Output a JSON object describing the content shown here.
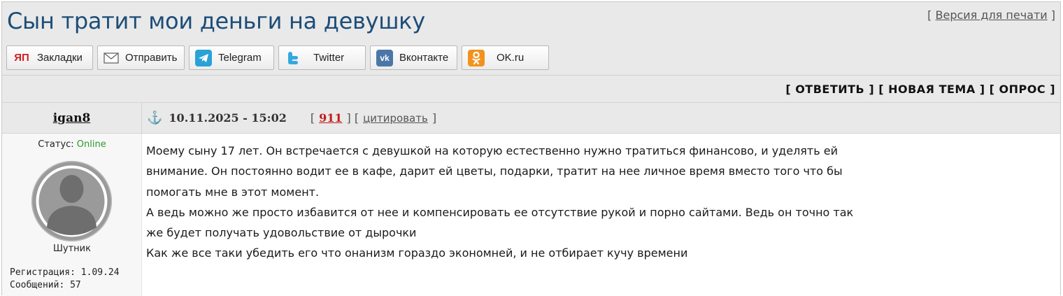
{
  "topic": {
    "title": "Сын тратит мои деньги на девушку",
    "print_prefix": "[ ",
    "print_label": "Версия для печати",
    "print_suffix": " ]"
  },
  "share_buttons": [
    {
      "label": "Закладки",
      "icon": "yandex-bookmarks-icon",
      "icon_text": "ЯП"
    },
    {
      "label": "Отправить",
      "icon": "envelope-icon"
    },
    {
      "label": "Telegram",
      "icon": "telegram-icon"
    },
    {
      "label": "Twitter",
      "icon": "twitter-icon"
    },
    {
      "label": "Вконтакте",
      "icon": "vk-icon",
      "icon_text": "vk"
    },
    {
      "label": "OK.ru",
      "icon": "odnoklassniki-icon"
    }
  ],
  "actions": {
    "reply": "[ ОТВЕТИТЬ ]",
    "new_topic": "[ НОВАЯ ТЕМА ]",
    "poll": "[ ОПРОС ]"
  },
  "post": {
    "author": "igan8",
    "date": "10.11.2025 - 15:02",
    "number": "911",
    "quote_label": "цитировать",
    "status_label": "Статус: ",
    "status_value": "Online",
    "rank": "Шутник",
    "registration": "Регистрация: 1.09.24",
    "messages": "Сообщений: 57",
    "lines": [
      "Моему сыну 17 лет. Он встречается с девушкой на которую естественно нужно тратиться финансово, и уделять ей",
      "внимание. Он постоянно водит ее в кафе, дарит ей цветы, подарки, тратит на нее личное время вместо того что бы",
      "помогать мне в этот момент.",
      "А ведь можно же просто избавится от нее и компенсировать ее отсутствие рукой и порно сайтами. Ведь он точно так",
      "же будет получать удовольствие от дырочки",
      "Как же все таки убедить его что онанизм гораздо экономней, и не отбирает кучу времени"
    ]
  },
  "colors": {
    "title": "#1d4d78",
    "online": "#2c9a2c",
    "post_number": "#c21a1a",
    "anchor": "#2f7fb3"
  }
}
